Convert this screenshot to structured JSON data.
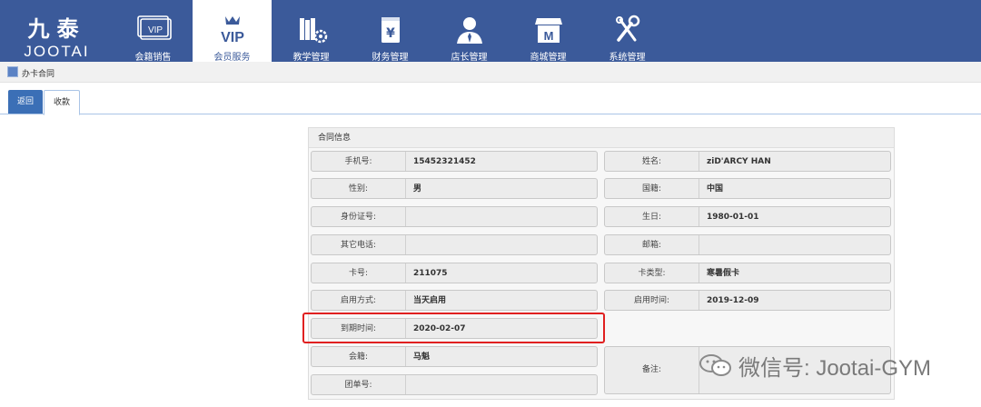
{
  "logo": {
    "cn": "九泰",
    "en": "JOOTAI",
    "vip_text": "VIP"
  },
  "nav": [
    {
      "label": "会籍销售",
      "icon": "vip-card-icon"
    },
    {
      "label": "会员服务",
      "icon": "vip-crown-icon",
      "active": true
    },
    {
      "label": "教学管理",
      "icon": "books-gear-icon"
    },
    {
      "label": "财务管理",
      "icon": "yen-box-icon"
    },
    {
      "label": "店长管理",
      "icon": "manager-icon"
    },
    {
      "label": "商城管理",
      "icon": "store-icon"
    },
    {
      "label": "系统管理",
      "icon": "tools-icon"
    }
  ],
  "breadcrumb": {
    "text": "办卡合同"
  },
  "tabs": {
    "back": "返回",
    "current": "收款"
  },
  "contract": {
    "title": "合同信息",
    "phone_label": "手机号:",
    "phone": "15452321452",
    "name_label": "姓名:",
    "name": "ziD'ARCY HAN",
    "gender_label": "性别:",
    "gender": "男",
    "nationality_label": "国籍:",
    "nationality": "中国",
    "id_label": "身份证号:",
    "id": "",
    "birthday_label": "生日:",
    "birthday": "1980-01-01",
    "other_phone_label": "其它电话:",
    "other_phone": "",
    "email_label": "邮箱:",
    "email": "",
    "card_no_label": "卡号:",
    "card_no": "211075",
    "card_type_label": "卡类型:",
    "card_type": "寒暑假卡",
    "activation_label": "启用方式:",
    "activation": "当天启用",
    "start_label": "启用时间:",
    "start": "2019-12-09",
    "expire_label": "到期时间:",
    "expire": "2020-02-07",
    "membership_label": "会籍:",
    "membership": "马魁",
    "remark_label": "备注:",
    "remark": "",
    "group_label": "团单号:",
    "group": ""
  },
  "watermark": {
    "text": "微信号: Jootai-GYM"
  },
  "colors": {
    "topbar": "#3b5a9a",
    "highlight": "#e02020",
    "tab_active": "#3b6fb6"
  }
}
